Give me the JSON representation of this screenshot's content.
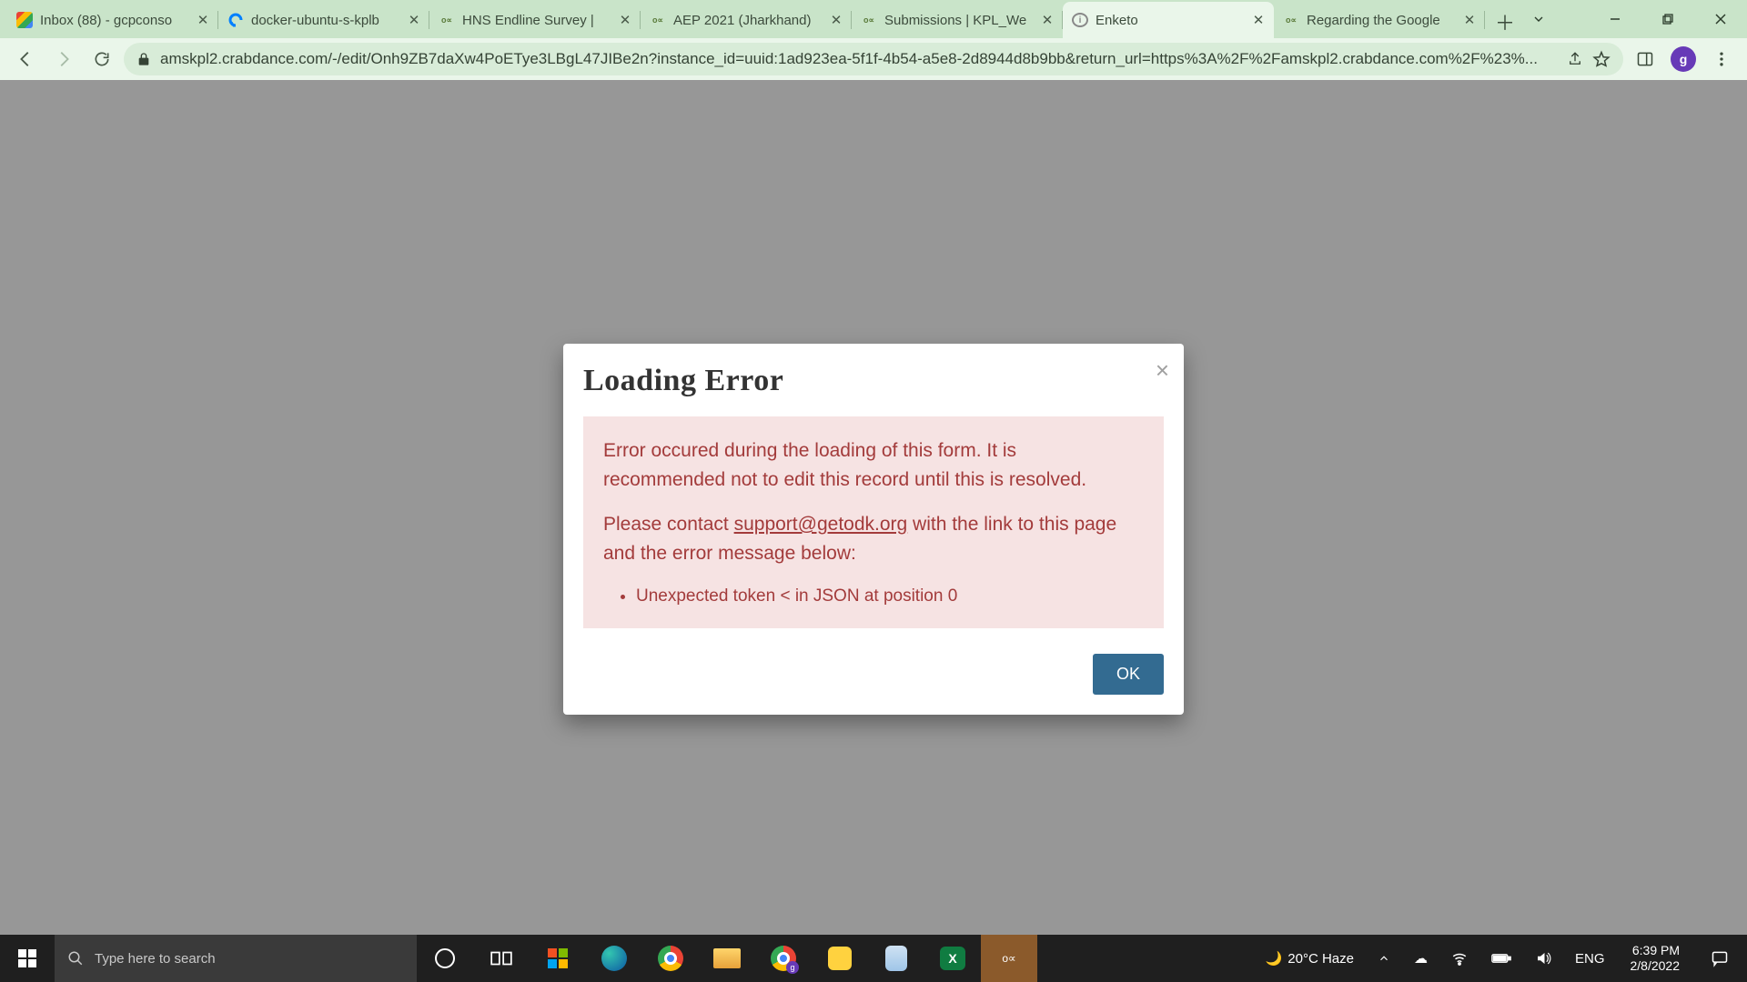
{
  "tabs": [
    {
      "title": "Inbox (88) - gcpconso",
      "icon": "gmail"
    },
    {
      "title": "docker-ubuntu-s-kplb",
      "icon": "do"
    },
    {
      "title": "HNS Endline Survey |",
      "icon": "odk"
    },
    {
      "title": "AEP 2021 (Jharkhand)",
      "icon": "odk"
    },
    {
      "title": "Submissions | KPL_We",
      "icon": "odk"
    },
    {
      "title": "Enketo",
      "icon": "enketo",
      "active": true
    },
    {
      "title": "Regarding the Google",
      "icon": "odk"
    }
  ],
  "omnibox": {
    "url": "amskpl2.crabdance.com/-/edit/Onh9ZB7daXw4PoETye3LBgL47JIBe2n?instance_id=uuid:1ad923ea-5f1f-4b54-a5e8-2d8944d8b9bb&return_url=https%3A%2F%2Famskpl2.crabdance.com%2F%23%..."
  },
  "modal": {
    "title": "Loading Error",
    "p1": "Error occured during the loading of this form. It is recommended not to edit this record until this is resolved.",
    "p2a": "Please contact ",
    "p2link": "support@getodk.org",
    "p2b": " with the link to this page and the error message below:",
    "bullet1": "Unexpected token < in JSON at position 0",
    "ok": "OK"
  },
  "taskbar": {
    "search_placeholder": "Type here to search",
    "weather": "20°C  Haze",
    "lang": "ENG",
    "time": "6:39 PM",
    "date": "2/8/2022"
  },
  "avatar_initial": "g"
}
